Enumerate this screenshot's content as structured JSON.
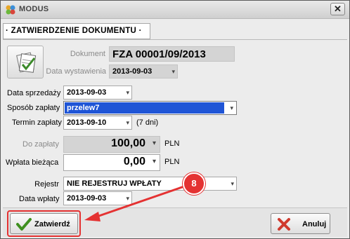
{
  "window": {
    "title": "MODUS"
  },
  "header": {
    "tab_label": "· ZATWIERDZENIE DOKUMENTU ·"
  },
  "document": {
    "label": "Dokument",
    "number": "FZA 00001/09/2013",
    "issue_date_label": "Data wystawienia",
    "issue_date": "2013-09-03"
  },
  "form": {
    "sale_date_label": "Data sprzedaży",
    "sale_date": "2013-09-03",
    "payment_method_label": "Sposób zapłaty",
    "payment_method": "przelew7",
    "payment_due_label": "Termin zapłaty",
    "payment_due": "2013-09-10",
    "payment_due_days": "(7 dni)",
    "to_pay_label": "Do zapłaty",
    "to_pay_amount": "100,00",
    "to_pay_currency": "PLN",
    "current_payment_label": "Wpłata bieżąca",
    "current_payment_amount": "0,00",
    "current_payment_currency": "PLN",
    "register_label": "Rejestr",
    "register_value": "NIE REJESTRUJ WPŁATY",
    "payment_date_label": "Data wpłaty",
    "payment_date": "2013-09-03"
  },
  "buttons": {
    "confirm_label": "Zatwierdź",
    "cancel_label": "Anuluj"
  },
  "annotation": {
    "step_number": "8",
    "color": "#e43232"
  },
  "icons": {
    "app": "modus-app-icon",
    "close": "close-icon",
    "document": "document-check-icon",
    "confirm": "checkmark-icon",
    "cancel": "cross-icon"
  }
}
